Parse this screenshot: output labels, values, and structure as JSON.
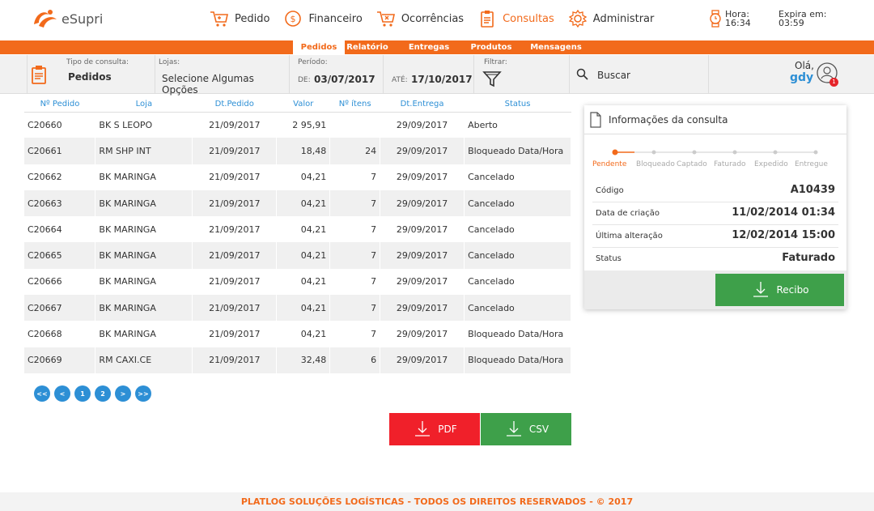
{
  "brand": {
    "name": "eSupri",
    "color": "#f26a1b"
  },
  "nav": [
    {
      "label": "Pedido",
      "icon": "cart-icon"
    },
    {
      "label": "Financeiro",
      "icon": "dollar-icon"
    },
    {
      "label": "Ocorrências",
      "icon": "cart-x-icon"
    },
    {
      "label": "Consultas",
      "icon": "clipboard-icon",
      "active": true
    },
    {
      "label": "Administrar",
      "icon": "gear-icon"
    }
  ],
  "clock": {
    "hora_label": "Hora:",
    "hora_value": "16:34",
    "expira_label": "Expira em:",
    "expira_value": "03:59"
  },
  "subnav": [
    "Pedidos",
    "Relatório",
    "Entregas",
    "Produtos",
    "Mensagens"
  ],
  "filters": {
    "tipo_label": "Tipo de consulta:",
    "tipo_value": "Pedidos",
    "lojas_label": "Lojas:",
    "lojas_value": "Selecione Algumas Opções",
    "periodo_label": "Período:",
    "de_label": "DE:",
    "de_value": "03/07/2017",
    "ate_label": "ATÉ:",
    "ate_value": "17/10/2017",
    "filtrar_label": "Filtrar:",
    "buscar_label": "Buscar",
    "ola_label": "Olá,",
    "user": "gdy",
    "notif_count": "1"
  },
  "table": {
    "headers": [
      "Nº Pedido",
      "Loja",
      "Dt.Pedido",
      "Valor",
      "Nº ítens",
      "Dt.Entrega",
      "Status"
    ],
    "rows": [
      [
        "C20660",
        "BK S LEOPO",
        "21/09/2017",
        "2   95,91",
        "",
        "29/09/2017",
        "Aberto"
      ],
      [
        "C20661",
        "RM SHP INT",
        "21/09/2017",
        "18,48",
        "24",
        "29/09/2017",
        "Bloqueado Data/Hora"
      ],
      [
        "C20662",
        "BK MARINGA",
        "21/09/2017",
        "04,21",
        "7",
        "29/09/2017",
        "Cancelado"
      ],
      [
        "C20663",
        "BK MARINGA",
        "21/09/2017",
        "04,21",
        "7",
        "29/09/2017",
        "Cancelado"
      ],
      [
        "C20664",
        "BK MARINGA",
        "21/09/2017",
        "04,21",
        "7",
        "29/09/2017",
        "Cancelado"
      ],
      [
        "C20665",
        "BK MARINGA",
        "21/09/2017",
        "04,21",
        "7",
        "29/09/2017",
        "Cancelado"
      ],
      [
        "C20666",
        "BK MARINGA",
        "21/09/2017",
        "04,21",
        "7",
        "29/09/2017",
        "Cancelado"
      ],
      [
        "C20667",
        "BK MARINGA",
        "21/09/2017",
        "04,21",
        "7",
        "29/09/2017",
        "Cancelado"
      ],
      [
        "C20668",
        "BK MARINGA",
        "21/09/2017",
        "04,21",
        "7",
        "29/09/2017",
        "Bloqueado Data/Hora"
      ],
      [
        "C20669",
        "RM CAXI.CE",
        "21/09/2017",
        "32,48",
        "6",
        "29/09/2017",
        "Bloqueado Data/Hora"
      ]
    ]
  },
  "pager": [
    "<<",
    "<",
    "1",
    "2",
    ">",
    ">>"
  ],
  "export": {
    "pdf": "PDF",
    "csv": "CSV",
    "pdf_color": "#f0202a",
    "csv_color": "#3ea04a"
  },
  "panel": {
    "title": "Informações da consulta",
    "steps": [
      "Pendente",
      "Bloqueado",
      "Captado",
      "Faturado",
      "Expedido",
      "Entregue"
    ],
    "rows": [
      {
        "k": "Código",
        "v": "A10439"
      },
      {
        "k": "Data de criação",
        "v": "11/02/2014 01:34"
      },
      {
        "k": "Última alteração",
        "v": "12/02/2014 15:00"
      },
      {
        "k": "Status",
        "v": "Faturado"
      }
    ],
    "recibo": "Recibo"
  },
  "footer": "PLATLOG SOLUÇÕES LOGÍSTICAS - TODOS OS DIREITOS RESERVADOS - © 2017"
}
